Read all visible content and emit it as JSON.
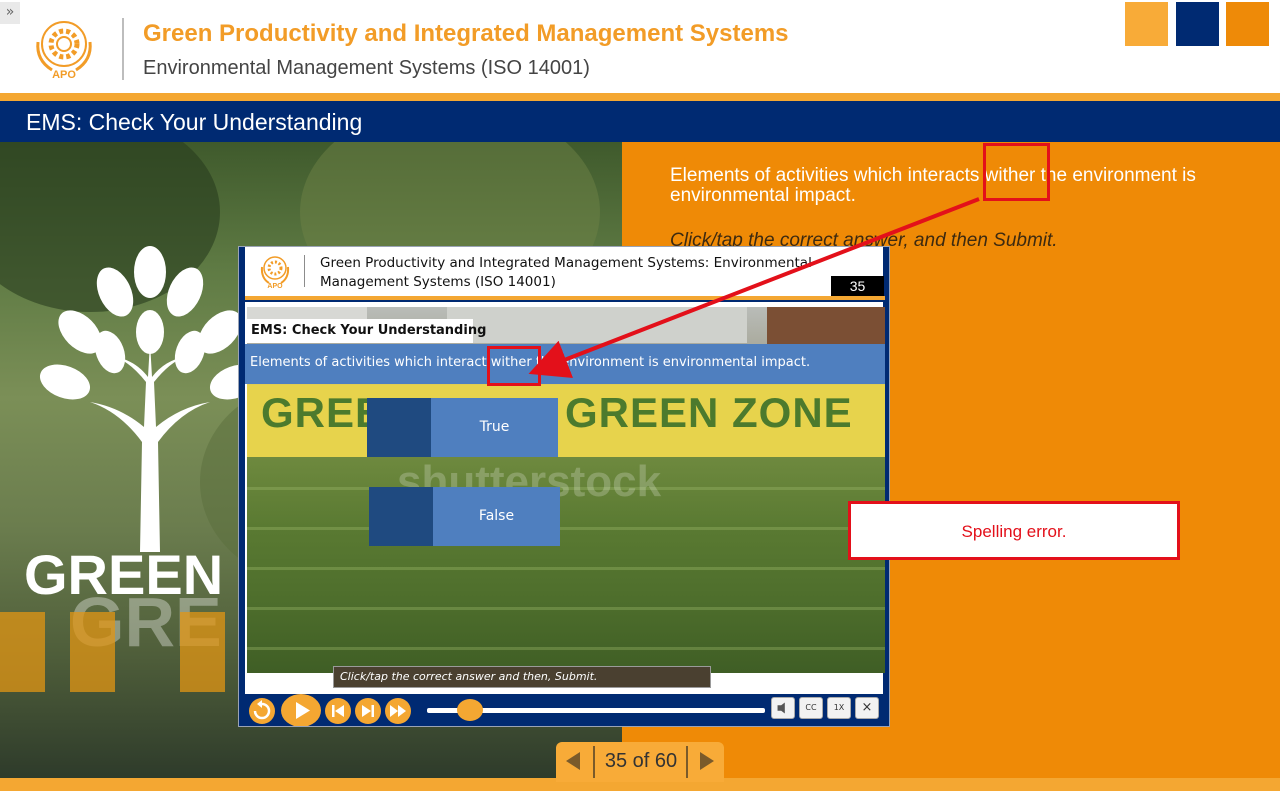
{
  "header": {
    "title": "Green Productivity and Integrated Management Systems",
    "subtitle": "Environmental Management Systems (ISO 14001)",
    "logo_text": "APO",
    "sidebar_toggle": "»"
  },
  "section": {
    "title": "EMS: Check Your Understanding"
  },
  "slide": {
    "question": "Elements of activities which interacts wither the environment is environmental impact.",
    "instruction": "Click/tap the correct answer, and then Submit.",
    "background_text": "GREEN"
  },
  "callout": {
    "text": "Spelling error."
  },
  "pager": {
    "label": "35 of 60"
  },
  "embedded_screenshot": {
    "title": "Green Productivity and Integrated Management Systems: Environmental Management Systems (ISO 14001)",
    "slide_number": "35",
    "heading": "EMS: Check Your Understanding",
    "question": "Elements of activities which interact wither the environment is environmental impact.",
    "answers": [
      "True",
      "False"
    ],
    "instruction": "Click/tap the correct answer and then, Submit.",
    "banner_text": "GREEN ZONE",
    "watermark": "shutterstock",
    "controls": [
      "replay-icon",
      "play-icon",
      "prev-icon",
      "next-icon",
      "fast-forward-icon",
      "volume-icon",
      "cc-icon",
      "speed-icon",
      "close-icon"
    ],
    "small_buttons": [
      "CC",
      "1X",
      "×"
    ]
  },
  "colors": {
    "accent_orange": "#ef8a06",
    "navy": "#002a72",
    "highlight_red": "#e3101a",
    "answer_blue": "#4f7fbf"
  }
}
